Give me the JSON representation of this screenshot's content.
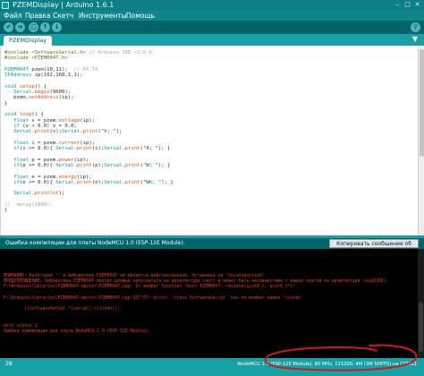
{
  "window": {
    "title": "PZEMDisplay | Arduino 1.6.1",
    "minimize_glyph": "–",
    "maximize_glyph": "□",
    "close_glyph": "✕"
  },
  "menu": {
    "items": [
      "Файл",
      "Правка",
      "Скетч",
      "Инструменты",
      "Помощь"
    ]
  },
  "toolbar": {
    "verify_glyph": "✔",
    "upload_glyph": "➜",
    "new_glyph": "□",
    "open_glyph": "↑",
    "save_glyph": "↓",
    "serial_monitor_glyph": "⚲"
  },
  "tabs": {
    "active": "PZEMDisplay",
    "menu_glyph": "▼"
  },
  "editor": {
    "lines": [
      [
        [
          "c-lib",
          "#include <SoftwareSerial.h>"
        ],
        [
          "c-cmt",
          " // Arduino IDE <1.6.6"
        ]
      ],
      [
        [
          "c-lib",
          "#include <PZEM004T.h>"
        ]
      ],
      [
        [
          "",
          ""
        ]
      ],
      [
        [
          "c-type",
          "PZEM004T"
        ],
        [
          "",
          " pzem(10,11);  "
        ],
        [
          "c-cmt",
          "// RX,TX"
        ]
      ],
      [
        [
          "c-type",
          "IPAddress"
        ],
        [
          "",
          " ip(192,168,1,1);"
        ]
      ],
      [
        [
          "",
          ""
        ]
      ],
      [
        [
          "c-type",
          "void"
        ],
        [
          "",
          " "
        ],
        [
          "c-func",
          "setup"
        ],
        [
          "",
          "() {"
        ]
      ],
      [
        [
          "",
          "   "
        ],
        [
          "c-type",
          "Serial"
        ],
        [
          "",
          "."
        ],
        [
          "c-func",
          "begin"
        ],
        [
          "",
          "(9600);"
        ]
      ],
      [
        [
          "",
          "   pzem."
        ],
        [
          "c-func",
          "setAddress"
        ],
        [
          "",
          "(ip);"
        ]
      ],
      [
        [
          "",
          "}"
        ]
      ],
      [
        [
          "",
          ""
        ]
      ],
      [
        [
          "c-type",
          "void"
        ],
        [
          "",
          " "
        ],
        [
          "c-func",
          "loop"
        ],
        [
          "",
          "() {"
        ]
      ],
      [
        [
          "",
          "   "
        ],
        [
          "c-type",
          "float"
        ],
        [
          "",
          " v = pzem."
        ],
        [
          "c-func",
          "voltage"
        ],
        [
          "",
          "(ip);"
        ]
      ],
      [
        [
          "",
          "   "
        ],
        [
          "c-type",
          "if"
        ],
        [
          "",
          " (v < 0.0) v = 0.0;"
        ]
      ],
      [
        [
          "",
          "   "
        ],
        [
          "c-type",
          "Serial"
        ],
        [
          "",
          "."
        ],
        [
          "c-func",
          "print"
        ],
        [
          "",
          "(v);"
        ],
        [
          "c-type",
          "Serial"
        ],
        [
          "",
          "."
        ],
        [
          "c-func",
          "print"
        ],
        [
          "",
          "("
        ],
        [
          "c-str",
          "\"V; \""
        ],
        [
          "",
          ");"
        ]
      ],
      [
        [
          "",
          ""
        ]
      ],
      [
        [
          "",
          "   "
        ],
        [
          "c-type",
          "float"
        ],
        [
          "",
          " i = pzem."
        ],
        [
          "c-func",
          "current"
        ],
        [
          "",
          "(ip);"
        ]
      ],
      [
        [
          "",
          "   "
        ],
        [
          "c-type",
          "if"
        ],
        [
          "",
          "(i >= 0.0){ "
        ],
        [
          "c-type",
          "Serial"
        ],
        [
          "",
          "."
        ],
        [
          "c-func",
          "print"
        ],
        [
          "",
          "(i);"
        ],
        [
          "c-type",
          "Serial"
        ],
        [
          "",
          "."
        ],
        [
          "c-func",
          "print"
        ],
        [
          "",
          "("
        ],
        [
          "c-str",
          "\"A; \""
        ],
        [
          "",
          "); }"
        ]
      ],
      [
        [
          "",
          ""
        ]
      ],
      [
        [
          "",
          "   "
        ],
        [
          "c-type",
          "float"
        ],
        [
          "",
          " p = pzem."
        ],
        [
          "c-func",
          "power"
        ],
        [
          "",
          "(ip);"
        ]
      ],
      [
        [
          "",
          "   "
        ],
        [
          "c-type",
          "if"
        ],
        [
          "",
          "(p >= 0.0){ "
        ],
        [
          "c-type",
          "Serial"
        ],
        [
          "",
          "."
        ],
        [
          "c-func",
          "print"
        ],
        [
          "",
          "(p);"
        ],
        [
          "c-type",
          "Serial"
        ],
        [
          "",
          "."
        ],
        [
          "c-func",
          "print"
        ],
        [
          "",
          "("
        ],
        [
          "c-str",
          "\"W; \""
        ],
        [
          "",
          "); }"
        ]
      ],
      [
        [
          "",
          ""
        ]
      ],
      [
        [
          "",
          "   "
        ],
        [
          "c-type",
          "float"
        ],
        [
          "",
          " e = pzem."
        ],
        [
          "c-func",
          "energy"
        ],
        [
          "",
          "(ip);"
        ]
      ],
      [
        [
          "",
          "   "
        ],
        [
          "c-type",
          "if"
        ],
        [
          "",
          "(e >= 0.0){ "
        ],
        [
          "c-type",
          "Serial"
        ],
        [
          "",
          "."
        ],
        [
          "c-func",
          "print"
        ],
        [
          "",
          "(e);"
        ],
        [
          "c-type",
          "Serial"
        ],
        [
          "",
          "."
        ],
        [
          "c-func",
          "print"
        ],
        [
          "",
          "("
        ],
        [
          "c-str",
          "\"Wh; \""
        ],
        [
          "",
          "); }"
        ]
      ],
      [
        [
          "",
          ""
        ]
      ],
      [
        [
          "",
          "   "
        ],
        [
          "c-type",
          "Serial"
        ],
        [
          "",
          "."
        ],
        [
          "c-func",
          "println"
        ],
        [
          "",
          "();"
        ]
      ],
      [
        [
          "",
          ""
        ]
      ],
      [
        [
          "c-cmt",
          "//  delay(1000);"
        ]
      ],
      [
        [
          "",
          "}"
        ]
      ]
    ]
  },
  "status": {
    "message": "Ошибка компиляции для платы NodeMCU 1.0 (ESP-12E Module).",
    "copy_button": "Копировать сообщение об ошибках"
  },
  "console": {
    "lines": [
      "ВНИМАНИЕ: Категория '' в библиотеке PZEM004T не является действительной. Установка на 'Uncategorized'",
      "ПРЕДУПРЕЖДЕНИЕ: библиотека PZEM004T-master должна запускаться на архитектуре (avr) и может быть несовместима с вашей платой на архитектуре (esp8266).",
      "F:\\Arduino\\libraries\\PZEM004T-master\\PZEM004T.cpp: In member function 'bool PZEM004T::recieve(uint8_t, uint8_t*)':",
      "",
      "F:\\Arduino\\libraries\\PZEM004T-master\\PZEM004T.cpp:137:57: error: 'class SoftwareSerial' has no member named 'listen'",
      "",
      "        ((SoftwareSerial *)serial)->listen();",
      "",
      "",
      "exit status 1",
      "Ошибка компиляции для платы NodeMCU 1.0 (ESP-12E Module)."
    ]
  },
  "footer": {
    "line_number": "28",
    "board_info": "NodeMCU 1.0 (ESP-12E Module), 80 MHz, 115200, 4M (3M SPIFFS) на COM11"
  },
  "colors": {
    "teal_dark": "#006468",
    "teal": "#17a1a5",
    "error_text": "#e8411f",
    "annotation": "#d11a1a"
  }
}
